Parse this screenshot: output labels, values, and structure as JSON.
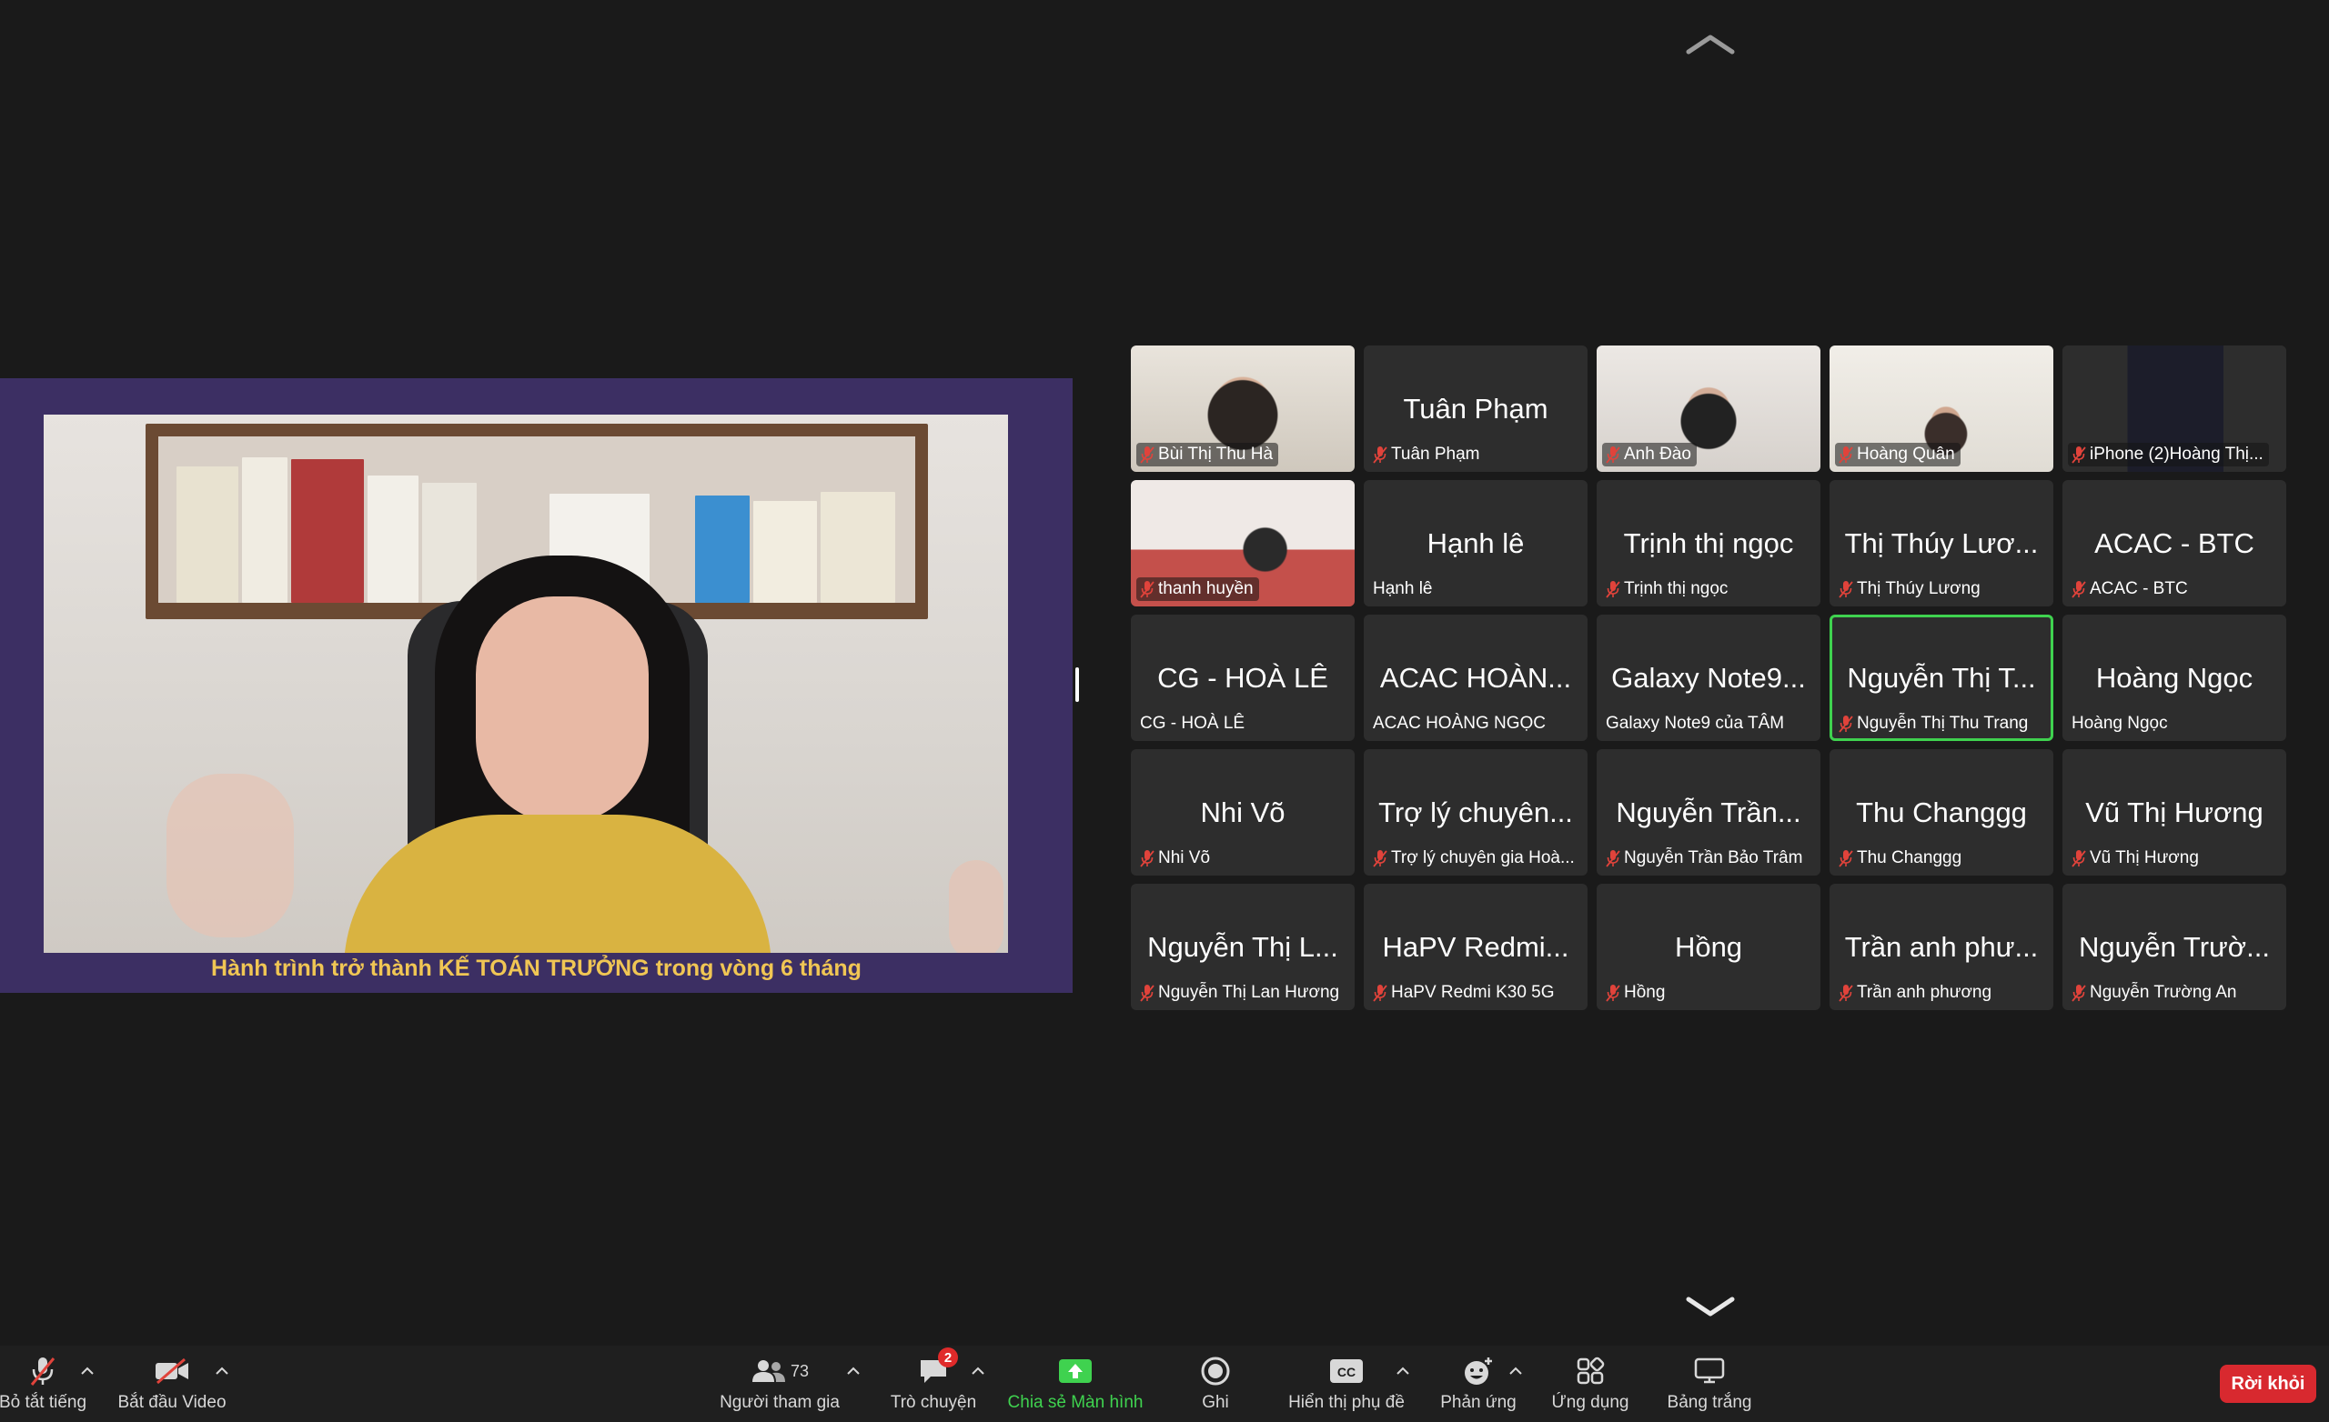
{
  "shared_screen": {
    "caption": "Hành trình trở thành KẾ TOÁN TRƯỞNG trong vòng 6 tháng"
  },
  "participants": [
    {
      "name": "Bùi Thị Thu Hà",
      "tile_text": "",
      "muted": true,
      "video": true
    },
    {
      "name": "Tuân Phạm",
      "tile_text": "Tuân Phạm",
      "muted": true,
      "video": false
    },
    {
      "name": "Anh Đào",
      "tile_text": "",
      "muted": true,
      "video": true
    },
    {
      "name": "Hoàng Quân",
      "tile_text": "",
      "muted": true,
      "video": true
    },
    {
      "name": "iPhone (2)Hoàng Thị...",
      "tile_text": "",
      "muted": true,
      "video": true
    },
    {
      "name": "thanh huyền",
      "tile_text": "",
      "muted": true,
      "video": true
    },
    {
      "name": "Hạnh lê",
      "tile_text": "Hạnh lê",
      "muted": false,
      "video": false
    },
    {
      "name": "Trịnh thị ngọc",
      "tile_text": "Trịnh thị ngọc",
      "muted": true,
      "video": false
    },
    {
      "name": "Thị Thúy Lương",
      "tile_text": "Thị Thúy Lươ...",
      "muted": true,
      "video": false
    },
    {
      "name": "ACAC - BTC",
      "tile_text": "ACAC - BTC",
      "muted": true,
      "video": false
    },
    {
      "name": "CG - HOÀ LÊ",
      "tile_text": "CG - HOÀ LÊ",
      "muted": false,
      "video": false
    },
    {
      "name": "ACAC HOÀNG NGỌC",
      "tile_text": "ACAC HOÀN...",
      "muted": false,
      "video": false
    },
    {
      "name": "Galaxy Note9 của TÂM",
      "tile_text": "Galaxy Note9...",
      "muted": false,
      "video": false
    },
    {
      "name": "Nguyễn Thị Thu Trang",
      "tile_text": "Nguyễn Thị T...",
      "muted": true,
      "video": false,
      "speaking": true
    },
    {
      "name": "Hoàng Ngọc",
      "tile_text": "Hoàng Ngọc",
      "muted": false,
      "video": false
    },
    {
      "name": "Nhi Võ",
      "tile_text": "Nhi Võ",
      "muted": true,
      "video": false
    },
    {
      "name": "Trợ lý chuyên gia Hoà...",
      "tile_text": "Trợ lý chuyên...",
      "muted": true,
      "video": false
    },
    {
      "name": "Nguyễn Trần Bảo Trâm",
      "tile_text": "Nguyễn Trần...",
      "muted": true,
      "video": false
    },
    {
      "name": "Thu Changgg",
      "tile_text": "Thu Changgg",
      "muted": true,
      "video": false
    },
    {
      "name": "Vũ Thị Hương",
      "tile_text": "Vũ Thị Hương",
      "muted": true,
      "video": false
    },
    {
      "name": "Nguyễn Thị Lan Hương",
      "tile_text": "Nguyễn Thị L...",
      "muted": true,
      "video": false
    },
    {
      "name": "HaPV Redmi K30 5G",
      "tile_text": "HaPV Redmi...",
      "muted": true,
      "video": false
    },
    {
      "name": "Hồng",
      "tile_text": "Hồng",
      "muted": true,
      "video": false
    },
    {
      "name": "Trần anh phương",
      "tile_text": "Trần anh phư...",
      "muted": true,
      "video": false
    },
    {
      "name": "Nguyễn Trường An",
      "tile_text": "Nguyễn Trườ...",
      "muted": true,
      "video": false
    }
  ],
  "toolbar": {
    "unmute": "Bỏ tắt tiếng",
    "start_video": "Bắt đầu Video",
    "participants": "Người tham gia",
    "participants_count": "73",
    "chat": "Trò chuyện",
    "chat_badge": "2",
    "share_screen": "Chia sẻ Màn hình",
    "record": "Ghi",
    "captions": "Hiển thị phụ đề",
    "captions_icon_text": "CC",
    "reactions": "Phản ứng",
    "apps": "Ứng dụng",
    "whiteboard": "Bảng trắng",
    "leave": "Rời khỏi"
  },
  "colors": {
    "background": "#1a1a1a",
    "tile": "#2d2d2d",
    "speaking_border": "#3fd24f",
    "muted_icon": "#e0433b",
    "share_green": "#3fd24f",
    "leave_red": "#d8292f",
    "caption_yellow": "#f0c654"
  }
}
